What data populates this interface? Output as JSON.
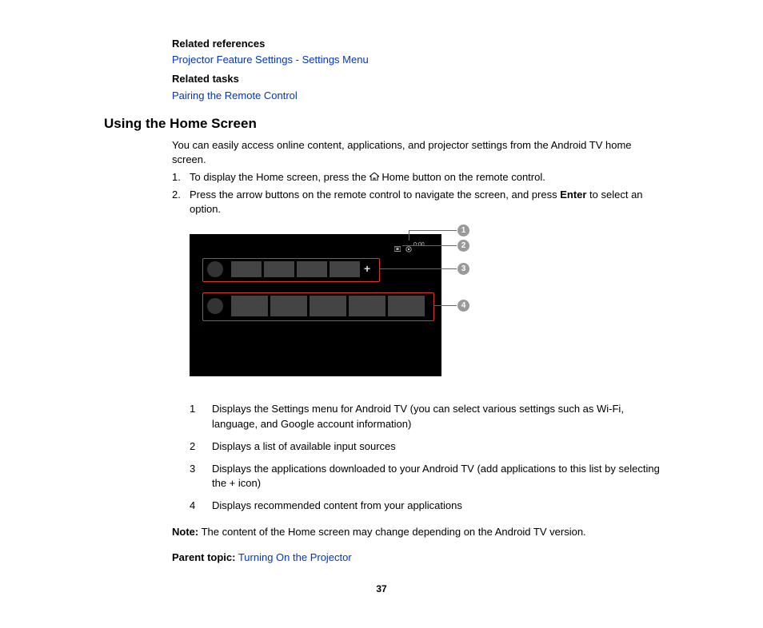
{
  "related_refs_head": "Related references",
  "related_ref_link": "Projector Feature Settings - Settings Menu",
  "related_tasks_head": "Related tasks",
  "related_task_link": "Pairing the Remote Control",
  "heading": "Using the Home Screen",
  "intro": "You can easily access online content, applications, and projector settings from the Android TV home screen.",
  "steps": {
    "1": {
      "pre": "To display the Home screen, press the ",
      "post": " Home button on the remote control."
    },
    "2": {
      "pre": "Press the arrow buttons on the remote control to navigate the screen, and press ",
      "bold": "Enter",
      "post": " to select an option."
    }
  },
  "figure": {
    "clock": "0:00",
    "plus": "+",
    "callouts": [
      "1",
      "2",
      "3",
      "4"
    ]
  },
  "legend": {
    "1": "Displays the Settings menu for Android TV (you can select various settings such as Wi-Fi, language, and Google account information)",
    "2": "Displays a list of available input sources",
    "3": "Displays the applications downloaded to your Android TV (add applications to this list by selecting the + icon)",
    "4": "Displays recommended content from your applications"
  },
  "note_label": "Note:",
  "note_text": " The content of the Home screen may change depending on the Android TV version.",
  "parent_label": "Parent topic:",
  "parent_link": " Turning On the Projector",
  "page_number": "37"
}
